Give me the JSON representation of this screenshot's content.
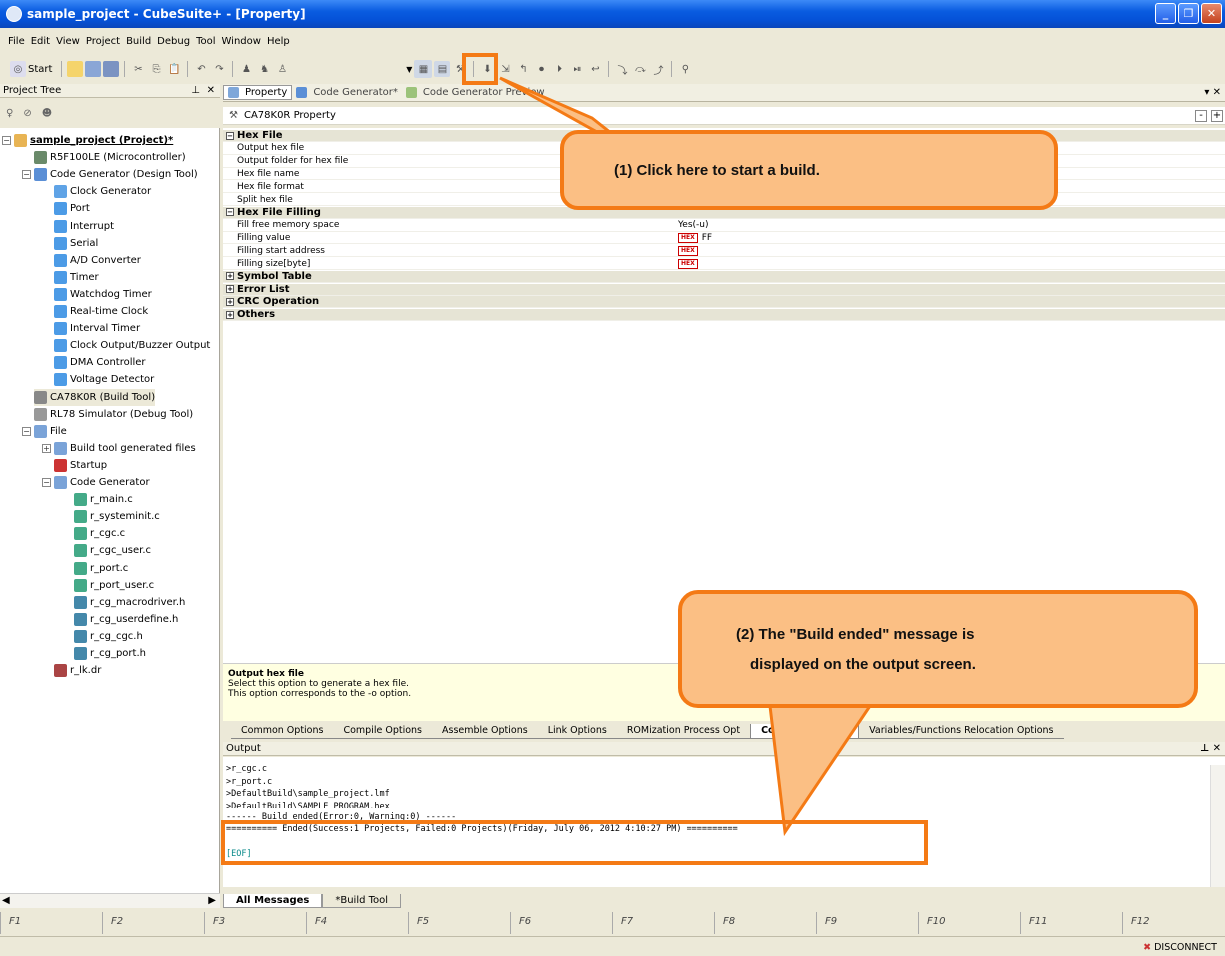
{
  "window": {
    "title": "sample_project - CubeSuite+ - [Property]"
  },
  "menu": [
    "File",
    "Edit",
    "View",
    "Project",
    "Build",
    "Debug",
    "Tool",
    "Window",
    "Help"
  ],
  "toolbar": {
    "start_label": "Start"
  },
  "project_tree": {
    "header": "Project Tree",
    "items": [
      {
        "label": "sample_project (Project)*",
        "icon": "project-icon",
        "depth": 0,
        "bold": true
      },
      {
        "label": "R5F100LE (Microcontroller)",
        "icon": "chip-icon",
        "depth": 1
      },
      {
        "label": "Code Generator (Design Tool)",
        "icon": "codegen-icon",
        "depth": 1
      },
      {
        "label": "Clock Generator",
        "icon": "clock-gen-icon",
        "depth": 2
      },
      {
        "label": "Port",
        "icon": "peripheral-icon",
        "depth": 2
      },
      {
        "label": "Interrupt",
        "icon": "peripheral-icon",
        "depth": 2
      },
      {
        "label": "Serial",
        "icon": "peripheral-icon",
        "depth": 2
      },
      {
        "label": "A/D Converter",
        "icon": "peripheral-icon",
        "depth": 2
      },
      {
        "label": "Timer",
        "icon": "peripheral-icon",
        "depth": 2
      },
      {
        "label": "Watchdog Timer",
        "icon": "peripheral-icon",
        "depth": 2
      },
      {
        "label": "Real-time Clock",
        "icon": "peripheral-icon",
        "depth": 2
      },
      {
        "label": "Interval Timer",
        "icon": "peripheral-icon",
        "depth": 2
      },
      {
        "label": "Clock Output/Buzzer Output",
        "icon": "peripheral-icon",
        "depth": 2
      },
      {
        "label": "DMA Controller",
        "icon": "peripheral-icon",
        "depth": 2
      },
      {
        "label": "Voltage Detector",
        "icon": "peripheral-icon",
        "depth": 2
      },
      {
        "label": "CA78K0R (Build Tool)",
        "icon": "build-tool-icon",
        "depth": 1
      },
      {
        "label": "RL78 Simulator (Debug Tool)",
        "icon": "debug-tool-icon",
        "depth": 1
      },
      {
        "label": "File",
        "icon": "folder-icon",
        "depth": 1
      },
      {
        "label": "Build tool generated files",
        "icon": "folder-icon",
        "depth": 2
      },
      {
        "label": "Startup",
        "icon": "startup-icon",
        "depth": 2
      },
      {
        "label": "Code Generator",
        "icon": "folder-icon",
        "depth": 2
      },
      {
        "label": "r_main.c",
        "icon": "c-file-icon",
        "depth": 3
      },
      {
        "label": "r_systeminit.c",
        "icon": "c-file-icon",
        "depth": 3
      },
      {
        "label": "r_cgc.c",
        "icon": "c-file-icon",
        "depth": 3
      },
      {
        "label": "r_cgc_user.c",
        "icon": "c-file-icon",
        "depth": 3
      },
      {
        "label": "r_port.c",
        "icon": "c-file-icon",
        "depth": 3
      },
      {
        "label": "r_port_user.c",
        "icon": "c-file-icon",
        "depth": 3
      },
      {
        "label": "r_cg_macrodriver.h",
        "icon": "h-file-icon",
        "depth": 3
      },
      {
        "label": "r_cg_userdefine.h",
        "icon": "h-file-icon",
        "depth": 3
      },
      {
        "label": "r_cg_cgc.h",
        "icon": "h-file-icon",
        "depth": 3
      },
      {
        "label": "r_cg_port.h",
        "icon": "h-file-icon",
        "depth": 3
      },
      {
        "label": "r_lk.dr",
        "icon": "dr-file-icon",
        "depth": 2
      }
    ]
  },
  "editor_tabs": [
    "Property",
    "Code Generator*",
    "Code Generator Preview"
  ],
  "property": {
    "header": "CA78K0R Property",
    "rows": [
      {
        "type": "cat",
        "name": "Hex File",
        "sign": "−"
      },
      {
        "type": "prop",
        "name": "Output hex file",
        "value": ""
      },
      {
        "type": "prop",
        "name": "Output folder for hex file",
        "value": ""
      },
      {
        "type": "prop",
        "name": "Hex file name",
        "value": ""
      },
      {
        "type": "prop",
        "name": "Hex file format",
        "value": ""
      },
      {
        "type": "prop",
        "name": "Split hex file",
        "value": ""
      },
      {
        "type": "cat",
        "name": "Hex File Filling",
        "sign": "−"
      },
      {
        "type": "prop",
        "name": "Fill free memory space",
        "value": "Yes(-u)"
      },
      {
        "type": "prop",
        "name": "Filling value",
        "value": "FF",
        "hex": true
      },
      {
        "type": "prop",
        "name": "Filling start address",
        "value": "",
        "hex": true
      },
      {
        "type": "prop",
        "name": "Filling size[byte]",
        "value": "",
        "hex": true
      },
      {
        "type": "cat",
        "name": "Symbol Table",
        "sign": "+"
      },
      {
        "type": "cat",
        "name": "Error List",
        "sign": "+"
      },
      {
        "type": "cat",
        "name": "CRC Operation",
        "sign": "+"
      },
      {
        "type": "cat",
        "name": "Others",
        "sign": "+"
      }
    ],
    "hex_badge": "HEX",
    "description": {
      "title": "Output hex file",
      "line1": "Select this option to generate a hex file.",
      "line2": "This option corresponds to the -o option."
    }
  },
  "option_tabs": [
    "Common Options",
    "Compile Options",
    "Assemble Options",
    "Link Options",
    "ROMization Process Opt",
    "Convert Options",
    "Variables/Functions Relocation Options"
  ],
  "output": {
    "header": "Output",
    "lines": [
      ">r_cgc.c",
      ">r_port.c",
      ">DefaultBuild\\sample_project.lmf",
      ">DefaultBuild\\SAMPLE_PROGRAM.hex",
      "------ Build ended(Error:0, Warning:0) ------",
      "========== Ended(Success:1 Projects, Failed:0 Projects)(Friday, July 06, 2012 4:10:27 PM) ==========",
      "",
      "[EOF]"
    ],
    "tabs": [
      "All Messages",
      "*Build Tool"
    ]
  },
  "fkeys": [
    "F1",
    "F2",
    "F3",
    "F4",
    "F5",
    "F6",
    "F7",
    "F8",
    "F9",
    "F10",
    "F11",
    "F12"
  ],
  "status": {
    "connection": "DISCONNECT"
  },
  "callouts": {
    "c1": "(1) Click here to start a build.",
    "c2a": "(2) The \"Build ended\" message is",
    "c2b": "displayed on the output screen."
  },
  "colors": {
    "callout_fill": "#fbbf84",
    "callout_border": "#f47a15",
    "titlebar": "#0a5ce0"
  }
}
